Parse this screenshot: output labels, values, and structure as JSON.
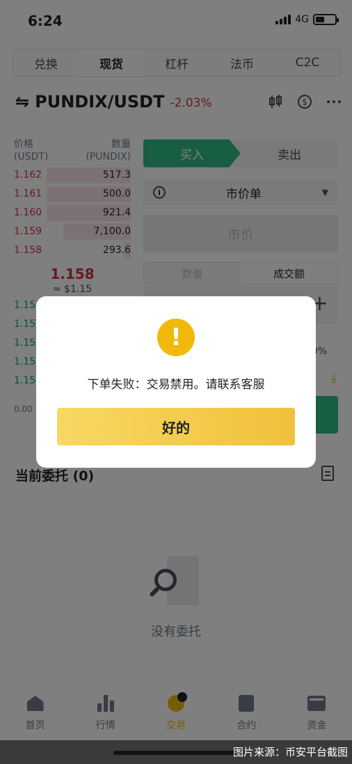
{
  "status_bar": {
    "time": "6:24",
    "network": "4G"
  },
  "trade_tabs": [
    "兑换",
    "现货",
    "杠杆",
    "法币",
    "C2C"
  ],
  "pair": {
    "swap_icon": "⇋",
    "name": "PUNDIX/USDT",
    "change": "-2.03%"
  },
  "orderbook": {
    "price_header": "价格",
    "price_unit": "(USDT)",
    "qty_header": "数量",
    "qty_unit": "(PUNDIX)",
    "asks": [
      {
        "price": "1.162",
        "qty": "517.3",
        "depth": 0.72
      },
      {
        "price": "1.161",
        "qty": "500.0",
        "depth": 0.72
      },
      {
        "price": "1.160",
        "qty": "921.4",
        "depth": 0.72
      },
      {
        "price": "1.159",
        "qty": "7,100.0",
        "depth": 0.58
      },
      {
        "price": "1.158",
        "qty": "293.6",
        "depth": 0.06
      }
    ],
    "last_price": "1.158",
    "last_fiat": "≈ $1.15",
    "bids": [
      "1.15",
      "1.15",
      "1.15",
      "1.15",
      "1.15"
    ],
    "bottom_value": "0.00"
  },
  "order_panel": {
    "buy": "买入",
    "sell": "卖出",
    "info_icon_text": "i",
    "order_type": "市价单",
    "price_placeholder": "市价",
    "amount_tab_qty": "数量",
    "amount_tab_turnover": "成交额",
    "plus": "+",
    "percent_text": "0%"
  },
  "open_orders": {
    "title": "当前委托 (0)",
    "empty_text": "没有委托"
  },
  "bottom_nav": [
    {
      "label": "首页",
      "icon": "home-icon"
    },
    {
      "label": "行情",
      "icon": "markets-icon"
    },
    {
      "label": "交易",
      "icon": "trade-icon"
    },
    {
      "label": "合约",
      "icon": "futures-icon"
    },
    {
      "label": "资金",
      "icon": "wallet-icon"
    }
  ],
  "dialog": {
    "icon": "!",
    "message": "下单失败：交易禁用。请联系客服",
    "button": "好的"
  },
  "watermark": "图片来源：币安平台截图",
  "colors": {
    "accent": "#f0b90b",
    "buy": "#2ebd85",
    "sell": "#cf304a"
  }
}
